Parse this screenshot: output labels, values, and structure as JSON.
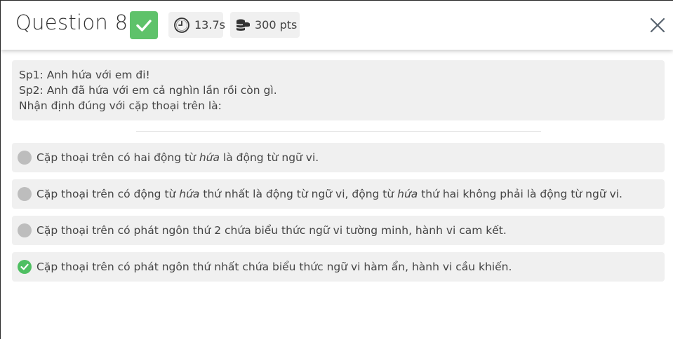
{
  "header": {
    "title": "Question 8",
    "time": "13.7s",
    "points": "300 pts"
  },
  "question": {
    "lines": [
      "Sp1: Anh hứa với em đi!",
      "Sp2: Anh đã hứa với em cả nghìn lần rồi còn gì.",
      "Nhận định đúng với cặp thoại trên là:"
    ]
  },
  "options": [
    {
      "parts": [
        "Cặp thoại trên có hai động từ ",
        "hứa",
        " là động từ ngữ vi."
      ],
      "correct": false
    },
    {
      "parts": [
        "Cặp thoại trên có động từ ",
        "hứa",
        " thứ nhất là động từ ngữ vi, động từ ",
        "hứa",
        " thứ hai không phải là động từ ngữ vi."
      ],
      "correct": false
    },
    {
      "parts": [
        "Cặp thoại trên có phát ngôn thứ 2 chứa biểu thức ngữ vi tường minh, hành vi cam kết."
      ],
      "correct": false
    },
    {
      "parts": [
        "Cặp thoại trên có phát ngôn thứ nhất chứa biểu thức ngữ vi hàm ẩn, hành vi cầu khiến."
      ],
      "correct": true
    }
  ],
  "icons": {
    "badge": "check-icon",
    "time": "clock-icon",
    "points": "coins-icon",
    "close": "close-icon",
    "option_unselected": "radio-dot-icon",
    "option_correct": "check-circle-icon"
  },
  "colors": {
    "correct_green": "#5ec26a",
    "option_bg": "#f0f0f0",
    "radio_gray": "#bdbdbd"
  }
}
